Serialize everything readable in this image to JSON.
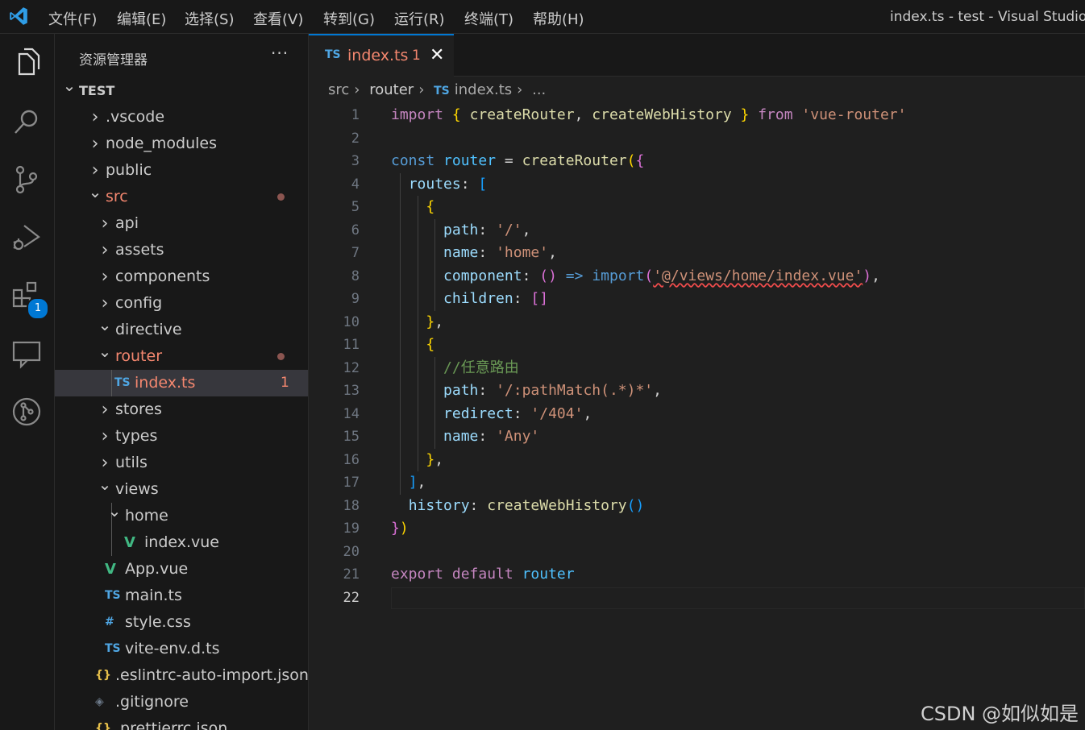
{
  "titlebar": {
    "menu": [
      "文件(F)",
      "编辑(E)",
      "选择(S)",
      "查看(V)",
      "转到(G)",
      "运行(R)",
      "终端(T)",
      "帮助(H)"
    ],
    "window_title": "index.ts - test - Visual Studio C"
  },
  "activitybar": {
    "items": [
      "explorer-icon",
      "search-icon",
      "source-control-icon",
      "run-debug-icon",
      "extensions-icon",
      "remote-explorer-icon",
      "git-graph-icon"
    ],
    "extensions_badge": "1"
  },
  "sidebar": {
    "title": "资源管理器",
    "more": "···",
    "tree": [
      {
        "label": "TEST",
        "depth": 0,
        "chevron": "down",
        "bold": true
      },
      {
        "label": ".vscode",
        "depth": 1,
        "chevron": "right"
      },
      {
        "label": "node_modules",
        "depth": 1,
        "chevron": "right"
      },
      {
        "label": "public",
        "depth": 1,
        "chevron": "right"
      },
      {
        "label": "src",
        "depth": 1,
        "chevron": "down",
        "modified": true,
        "dot": true
      },
      {
        "label": "api",
        "depth": 2,
        "chevron": "right"
      },
      {
        "label": "assets",
        "depth": 2,
        "chevron": "right"
      },
      {
        "label": "components",
        "depth": 2,
        "chevron": "right"
      },
      {
        "label": "config",
        "depth": 2,
        "chevron": "right"
      },
      {
        "label": "directive",
        "depth": 2,
        "chevron": "down"
      },
      {
        "label": "router",
        "depth": 2,
        "chevron": "down",
        "modified": true,
        "dot": true
      },
      {
        "label": "index.ts",
        "depth": 3,
        "icon": "TS",
        "modified": true,
        "count": "1",
        "selected": true
      },
      {
        "label": "stores",
        "depth": 2,
        "chevron": "right"
      },
      {
        "label": "types",
        "depth": 2,
        "chevron": "right"
      },
      {
        "label": "utils",
        "depth": 2,
        "chevron": "right"
      },
      {
        "label": "views",
        "depth": 2,
        "chevron": "down"
      },
      {
        "label": "home",
        "depth": 3,
        "chevron": "down"
      },
      {
        "label": "index.vue",
        "depth": 4,
        "icon": "V"
      },
      {
        "label": "App.vue",
        "depth": 2,
        "icon": "V"
      },
      {
        "label": "main.ts",
        "depth": 2,
        "icon": "TS"
      },
      {
        "label": "style.css",
        "depth": 2,
        "icon": "#"
      },
      {
        "label": "vite-env.d.ts",
        "depth": 2,
        "icon": "TS"
      },
      {
        "label": ".eslintrc-auto-import.json",
        "depth": 1,
        "icon": "{}"
      },
      {
        "label": ".gitignore",
        "depth": 1,
        "icon": "◈"
      },
      {
        "label": ".prettierrc.json",
        "depth": 1,
        "icon": "{}"
      }
    ]
  },
  "tab": {
    "icon": "TS",
    "name": "index.ts",
    "problems": "1",
    "close": "✕"
  },
  "breadcrumb": [
    "src",
    "router",
    "index.ts",
    "..."
  ],
  "editor": {
    "current_line": 22,
    "lines": [
      [
        [
          "kw",
          "import"
        ],
        [
          "pu",
          " "
        ],
        [
          "b1",
          "{"
        ],
        [
          "pu",
          " "
        ],
        [
          "fn",
          "createRouter"
        ],
        [
          "pu",
          ", "
        ],
        [
          "fn",
          "createWebHistory"
        ],
        [
          "pu",
          " "
        ],
        [
          "b1",
          "}"
        ],
        [
          "pu",
          " "
        ],
        [
          "kw",
          "from"
        ],
        [
          "pu",
          " "
        ],
        [
          "st",
          "'vue-router'"
        ]
      ],
      [],
      [
        [
          "kb",
          "const"
        ],
        [
          "pu",
          " "
        ],
        [
          "cn",
          "router"
        ],
        [
          "pu",
          " = "
        ],
        [
          "fn",
          "createRouter"
        ],
        [
          "b1",
          "("
        ],
        [
          "b2",
          "{"
        ]
      ],
      [
        [
          "pu",
          "  "
        ],
        [
          "vr",
          "routes"
        ],
        [
          "pu",
          ": "
        ],
        [
          "b3",
          "["
        ]
      ],
      [
        [
          "pu",
          "    "
        ],
        [
          "b1",
          "{"
        ]
      ],
      [
        [
          "pu",
          "      "
        ],
        [
          "vr",
          "path"
        ],
        [
          "pu",
          ": "
        ],
        [
          "st",
          "'/'"
        ],
        [
          "pu",
          ","
        ]
      ],
      [
        [
          "pu",
          "      "
        ],
        [
          "vr",
          "name"
        ],
        [
          "pu",
          ": "
        ],
        [
          "st",
          "'home'"
        ],
        [
          "pu",
          ","
        ]
      ],
      [
        [
          "pu",
          "      "
        ],
        [
          "vr",
          "component"
        ],
        [
          "pu",
          ": "
        ],
        [
          "b2",
          "()"
        ],
        [
          "pu",
          " "
        ],
        [
          "kb",
          "=>"
        ],
        [
          "pu",
          " "
        ],
        [
          "kb",
          "import"
        ],
        [
          "b2",
          "("
        ],
        [
          "stsq",
          "'@/views/home/index.vue'"
        ],
        [
          "b2",
          ")"
        ],
        [
          "pu",
          ","
        ]
      ],
      [
        [
          "pu",
          "      "
        ],
        [
          "vr",
          "children"
        ],
        [
          "pu",
          ": "
        ],
        [
          "b2",
          "[]"
        ]
      ],
      [
        [
          "pu",
          "    "
        ],
        [
          "b1",
          "}"
        ],
        [
          "pu",
          ","
        ]
      ],
      [
        [
          "pu",
          "    "
        ],
        [
          "b1",
          "{"
        ]
      ],
      [
        [
          "pu",
          "      "
        ],
        [
          "cm",
          "//任意路由"
        ]
      ],
      [
        [
          "pu",
          "      "
        ],
        [
          "vr",
          "path"
        ],
        [
          "pu",
          ": "
        ],
        [
          "st",
          "'/:pathMatch(.*)*'"
        ],
        [
          "pu",
          ","
        ]
      ],
      [
        [
          "pu",
          "      "
        ],
        [
          "vr",
          "redirect"
        ],
        [
          "pu",
          ": "
        ],
        [
          "st",
          "'/404'"
        ],
        [
          "pu",
          ","
        ]
      ],
      [
        [
          "pu",
          "      "
        ],
        [
          "vr",
          "name"
        ],
        [
          "pu",
          ": "
        ],
        [
          "st",
          "'Any'"
        ]
      ],
      [
        [
          "pu",
          "    "
        ],
        [
          "b1",
          "}"
        ],
        [
          "pu",
          ","
        ]
      ],
      [
        [
          "pu",
          "  "
        ],
        [
          "b3",
          "]"
        ],
        [
          "pu",
          ","
        ]
      ],
      [
        [
          "pu",
          "  "
        ],
        [
          "vr",
          "history"
        ],
        [
          "pu",
          ": "
        ],
        [
          "fn",
          "createWebHistory"
        ],
        [
          "b3",
          "()"
        ]
      ],
      [
        [
          "b2",
          "}"
        ],
        [
          "b1",
          ")"
        ]
      ],
      [],
      [
        [
          "kw",
          "export"
        ],
        [
          "pu",
          " "
        ],
        [
          "kw",
          "default"
        ],
        [
          "pu",
          " "
        ],
        [
          "cn",
          "router"
        ]
      ],
      []
    ]
  },
  "watermark": "CSDN @如似如是"
}
